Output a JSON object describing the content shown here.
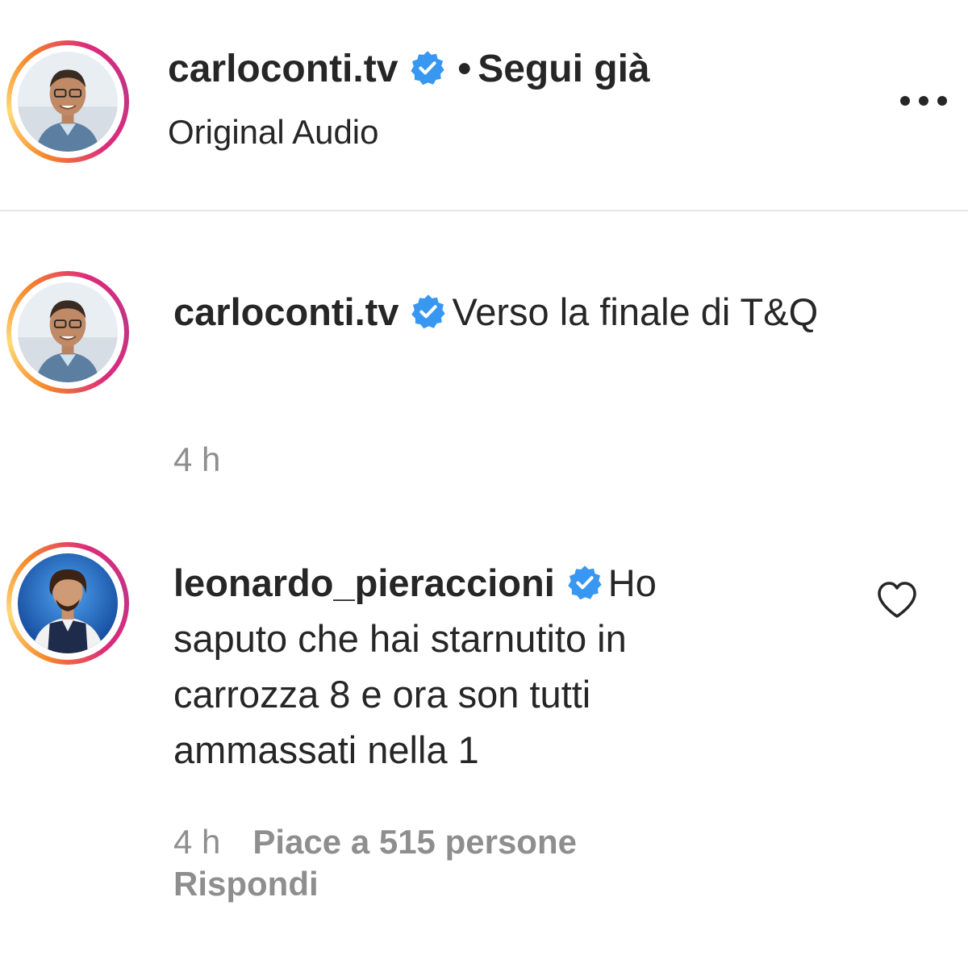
{
  "header": {
    "username": "carloconti.tv",
    "separator": "•",
    "follow_label": "Segui già",
    "subtitle": "Original Audio",
    "more_icon": "more-horizontal-icon"
  },
  "caption": {
    "username": "carloconti.tv",
    "text": "Verso la finale di T&Q",
    "time": "4 h"
  },
  "comment": {
    "username": "leonardo_pieraccioni",
    "text": "Ho saputo che hai starnutito in carrozza 8 e ora son tutti ammassati nella 1",
    "time": "4 h",
    "likes_label": "Piace a 515 persone",
    "reply_label": "Rispondi",
    "like_icon": "heart-outline-icon"
  },
  "colors": {
    "verified_blue": "#3897f0",
    "text": "#262626",
    "secondary_text": "#8e8e8e",
    "divider": "#e6e6e6"
  }
}
